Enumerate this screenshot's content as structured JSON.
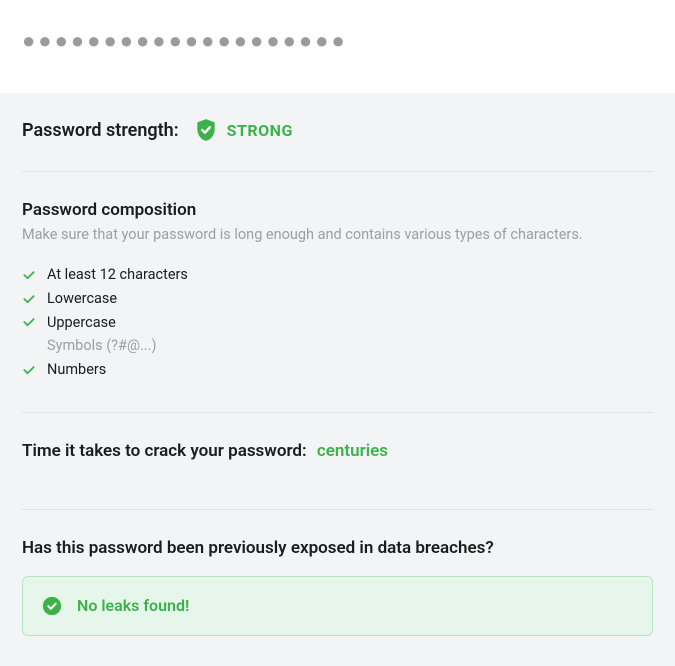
{
  "input": {
    "value": "●●●●●●●●●●●●●●●●●●●●"
  },
  "strength": {
    "label": "Password strength:",
    "value": "STRONG",
    "color": "#3db24b"
  },
  "composition": {
    "title": "Password composition",
    "subtext": "Make sure that your password is long enough and contains various types of characters.",
    "criteria": [
      {
        "label": "At least 12 characters",
        "met": true
      },
      {
        "label": "Lowercase",
        "met": true
      },
      {
        "label": "Uppercase",
        "met": true
      },
      {
        "label": "Symbols (?#@...)",
        "met": false
      },
      {
        "label": "Numbers",
        "met": true
      }
    ]
  },
  "crack": {
    "label": "Time it takes to crack your password:",
    "value": "centuries"
  },
  "breach": {
    "title": "Has this password been previously exposed in data breaches?",
    "result": "No leaks found!",
    "status": "safe"
  }
}
